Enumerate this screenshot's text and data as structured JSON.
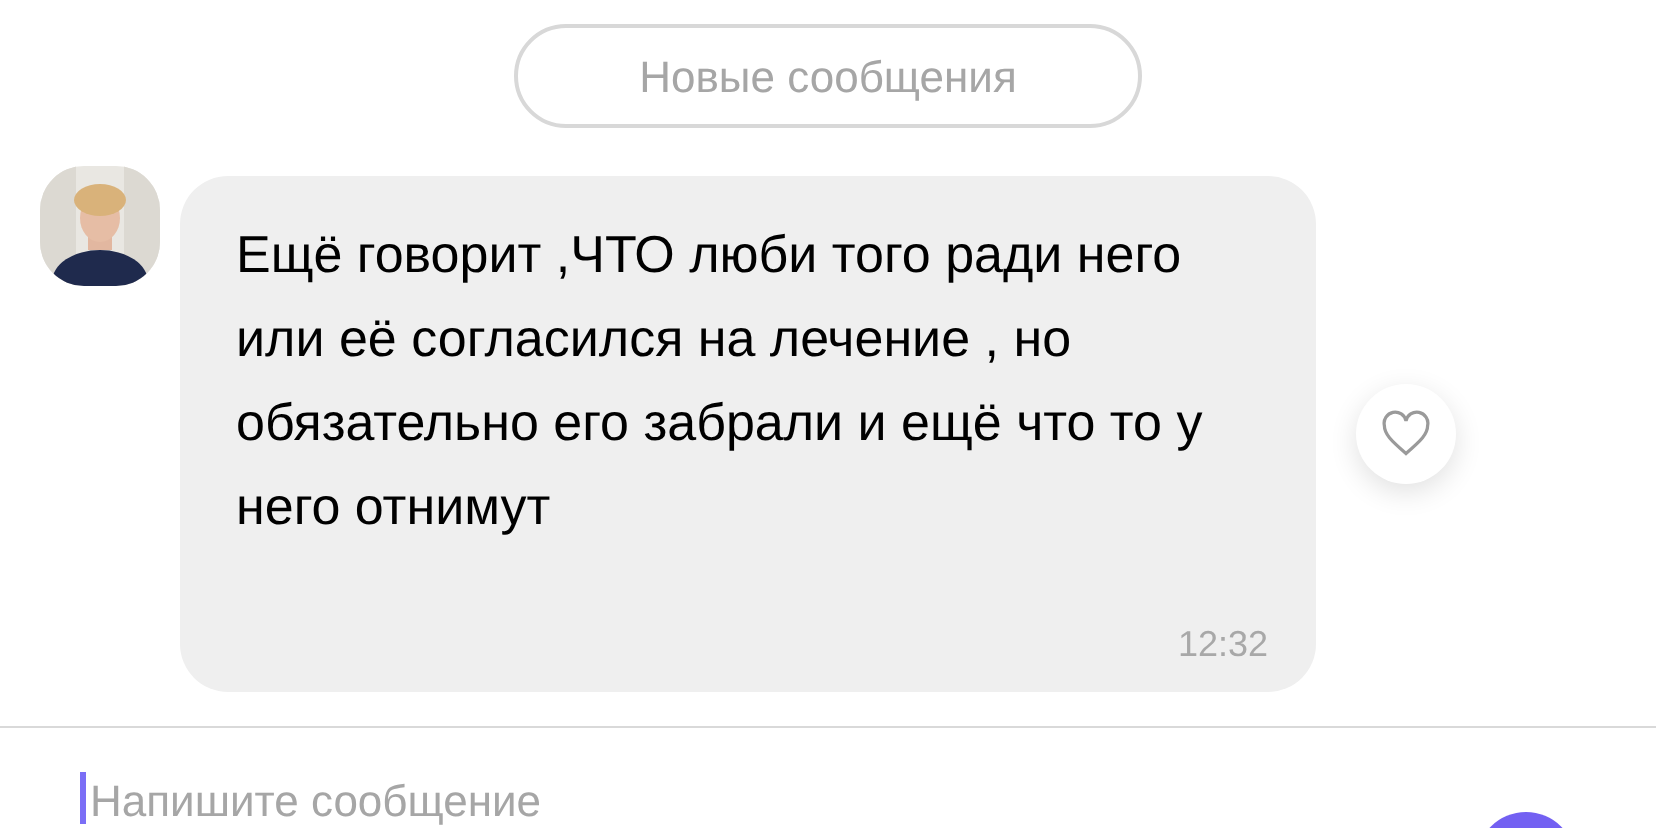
{
  "new_messages_button": "Новые сообщения",
  "message": {
    "text": "Ещё говорит ,ЧТО люби того ради него или её согласился на лечение , но обязательно его забрали и ещё что то у него отнимут",
    "time": "12:32",
    "liked": false
  },
  "composer": {
    "placeholder": "Напишите сообщение"
  }
}
